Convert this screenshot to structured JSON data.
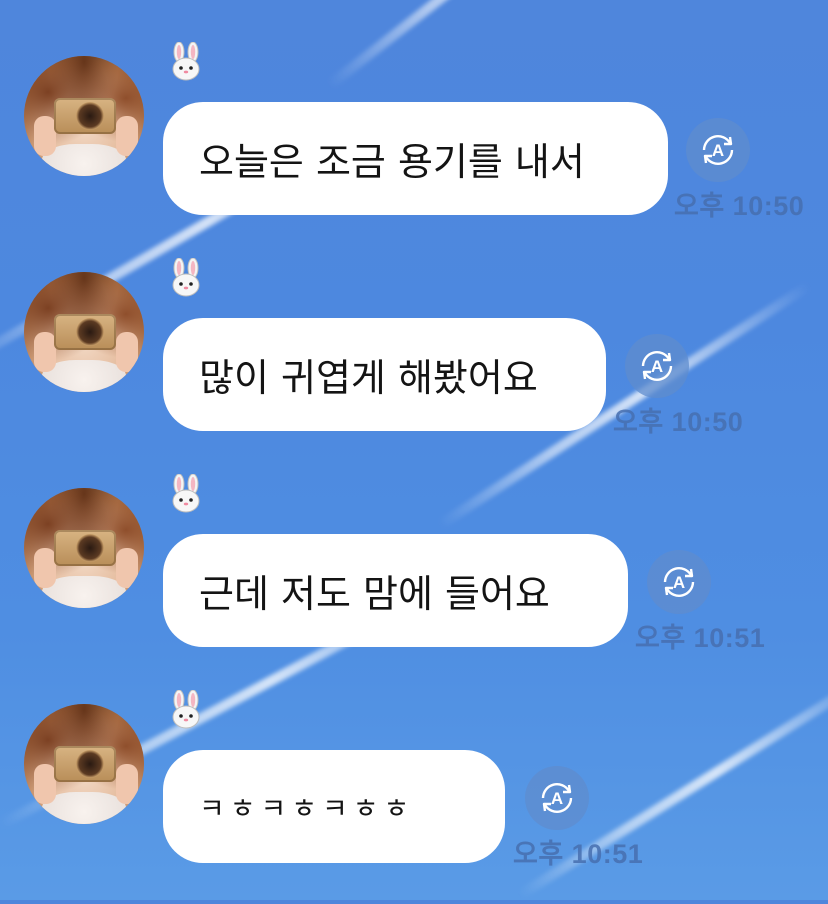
{
  "messages": [
    {
      "text": "오늘은 조금 용기를 내서",
      "time": "오후 10:50",
      "sender_icon": "bunny-face-icon",
      "translate_icon": "translate-a-icon"
    },
    {
      "text": "많이 귀엽게 해봤어요",
      "time": "오후 10:50",
      "sender_icon": "bunny-face-icon",
      "translate_icon": "translate-a-icon"
    },
    {
      "text": "근데 저도 맘에 들어요",
      "time": "오후 10:51",
      "sender_icon": "bunny-face-icon",
      "translate_icon": "translate-a-icon"
    },
    {
      "text": "ㅋㅎㅋㅎㅋㅎㅎ",
      "time": "오후 10:51",
      "sender_icon": "bunny-face-icon",
      "translate_icon": "translate-a-icon"
    }
  ],
  "colors": {
    "sky": "#4f8ee2",
    "bubble": "#ffffff",
    "text": "#141414",
    "time": "#466eaf",
    "translate_button": "#5f8ccd"
  }
}
